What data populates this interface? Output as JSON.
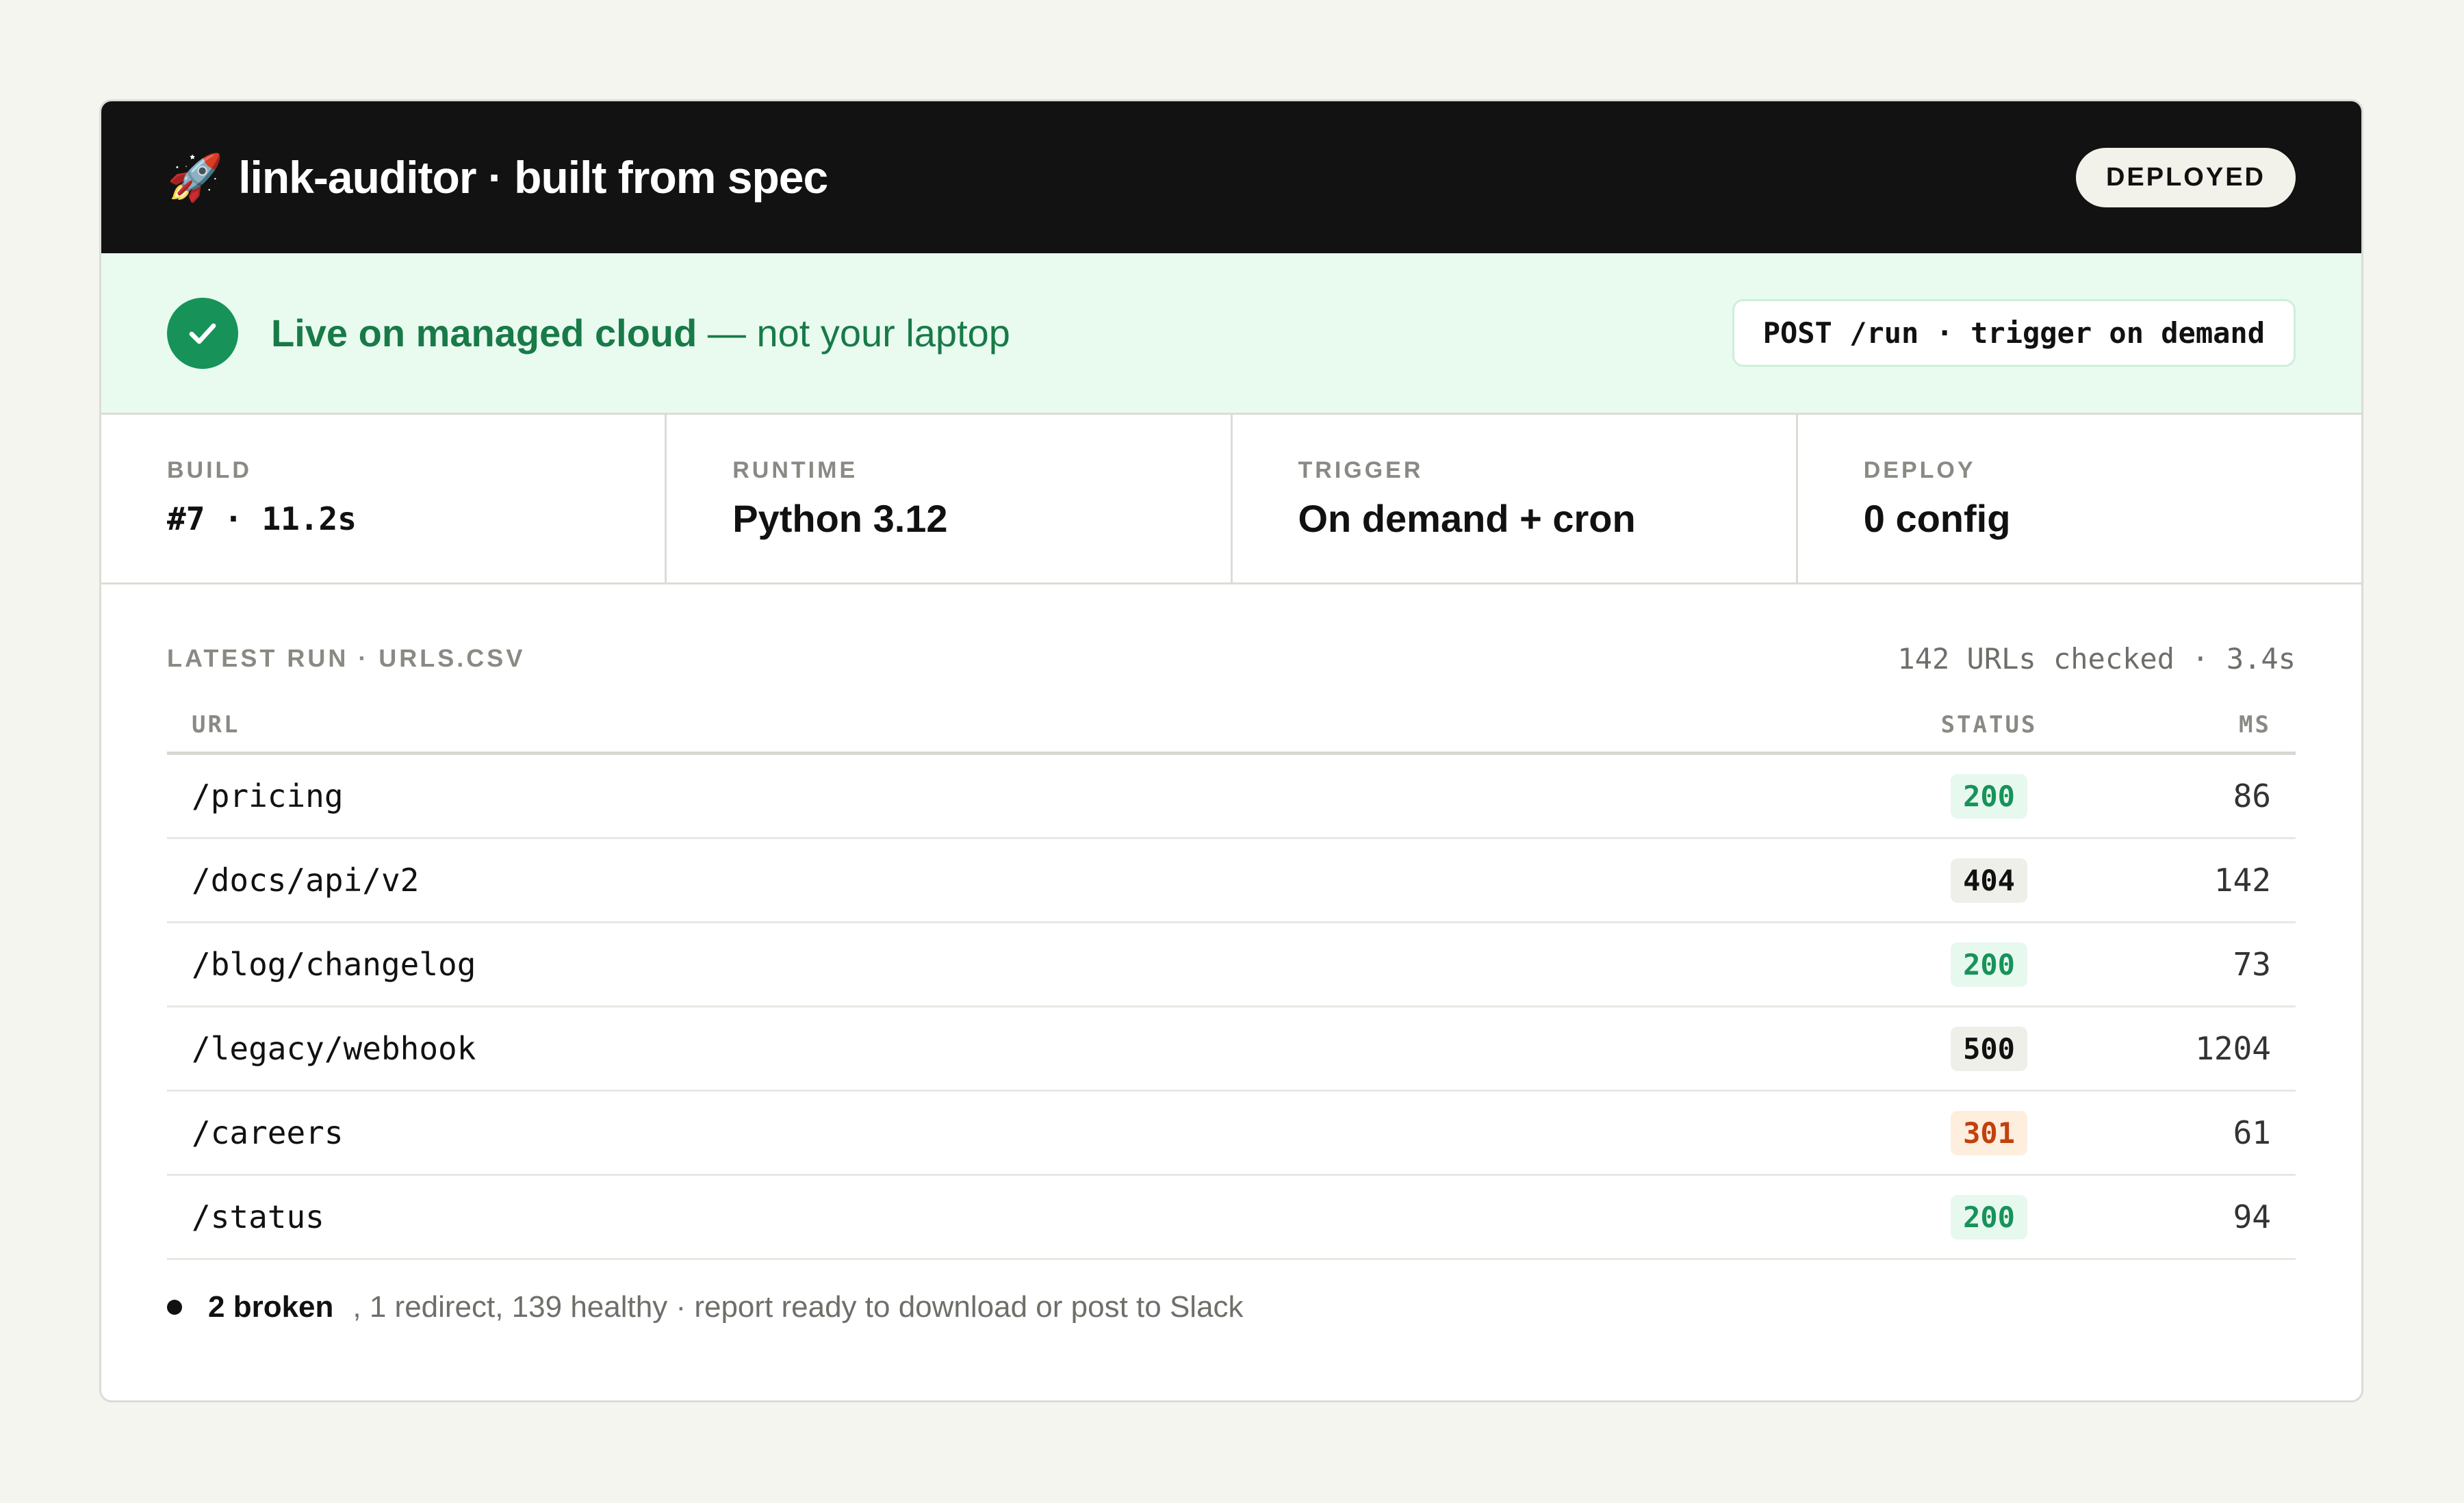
{
  "header": {
    "icon": "rocket-icon",
    "rocket_glyph": "🚀",
    "title": "link-auditor · built from spec",
    "badge": "DEPLOYED"
  },
  "live": {
    "icon": "check-circle-icon",
    "strong": "Live on managed cloud",
    "rest": " — not your laptop",
    "endpoint": "POST /run · trigger on demand"
  },
  "stats": [
    {
      "label": "BUILD",
      "value": "#7 · 11.2s"
    },
    {
      "label": "RUNTIME",
      "value": "Python 3.12"
    },
    {
      "label": "TRIGGER",
      "value": "On demand + cron"
    },
    {
      "label": "DEPLOY",
      "value": "0 config"
    }
  ],
  "run": {
    "title": "LATEST RUN · URLS.CSV",
    "summary": "142 URLs checked · 3.4s",
    "columns": {
      "url": "URL",
      "status": "STATUS",
      "ms": "MS"
    },
    "rows": [
      {
        "url": "/pricing",
        "status": "200",
        "ms": "86"
      },
      {
        "url": "/docs/api/v2",
        "status": "404",
        "ms": "142"
      },
      {
        "url": "/blog/changelog",
        "status": "200",
        "ms": "73"
      },
      {
        "url": "/legacy/webhook",
        "status": "500",
        "ms": "1204"
      },
      {
        "url": "/careers",
        "status": "301",
        "ms": "61"
      },
      {
        "url": "/status",
        "status": "200",
        "ms": "94"
      }
    ]
  },
  "footer": {
    "broken": "2 broken",
    "rest": ", 1 redirect, 139 healthy · report ready to download or post to Slack"
  },
  "colors": {
    "header_bg": "#121212",
    "live_bg": "#e9fbef",
    "success": "#17935a",
    "redirect": "#c2410c",
    "page_bg": "#f5f5f0"
  }
}
